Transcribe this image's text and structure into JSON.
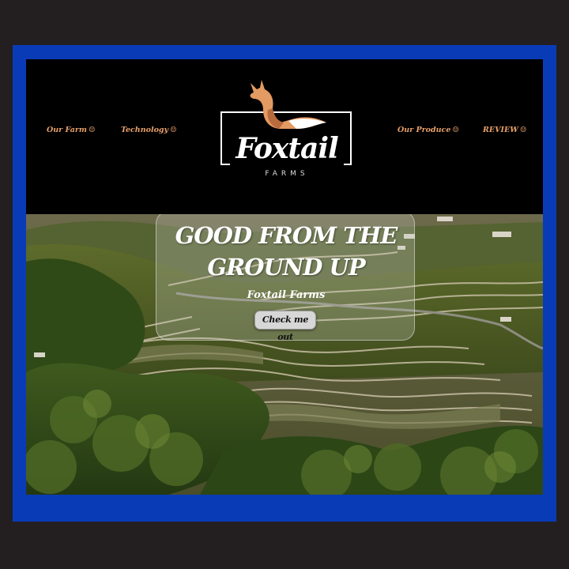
{
  "nav": {
    "left": [
      {
        "label": "Our Farm",
        "icon": "smiley-icon"
      },
      {
        "label": "Technology",
        "icon": "smiley-icon"
      }
    ],
    "right": [
      {
        "label": "Our Produce",
        "icon": "smiley-icon"
      },
      {
        "label": "REVIEW",
        "icon": "smiley-icon"
      }
    ],
    "smiley": "☺"
  },
  "logo": {
    "name": "Foxtail",
    "sub": "FARMS"
  },
  "hero": {
    "title_line1": "GOOD FROM THE",
    "title_line2": "GROUND UP",
    "subtitle": "Foxtail Farms",
    "button_label": "Check me out"
  },
  "colors": {
    "frame": "#0a3bb7",
    "nav_link": "#e8a06a",
    "fox": "#e39a63",
    "header_bg": "#000000",
    "page_bg": "#231f20"
  }
}
